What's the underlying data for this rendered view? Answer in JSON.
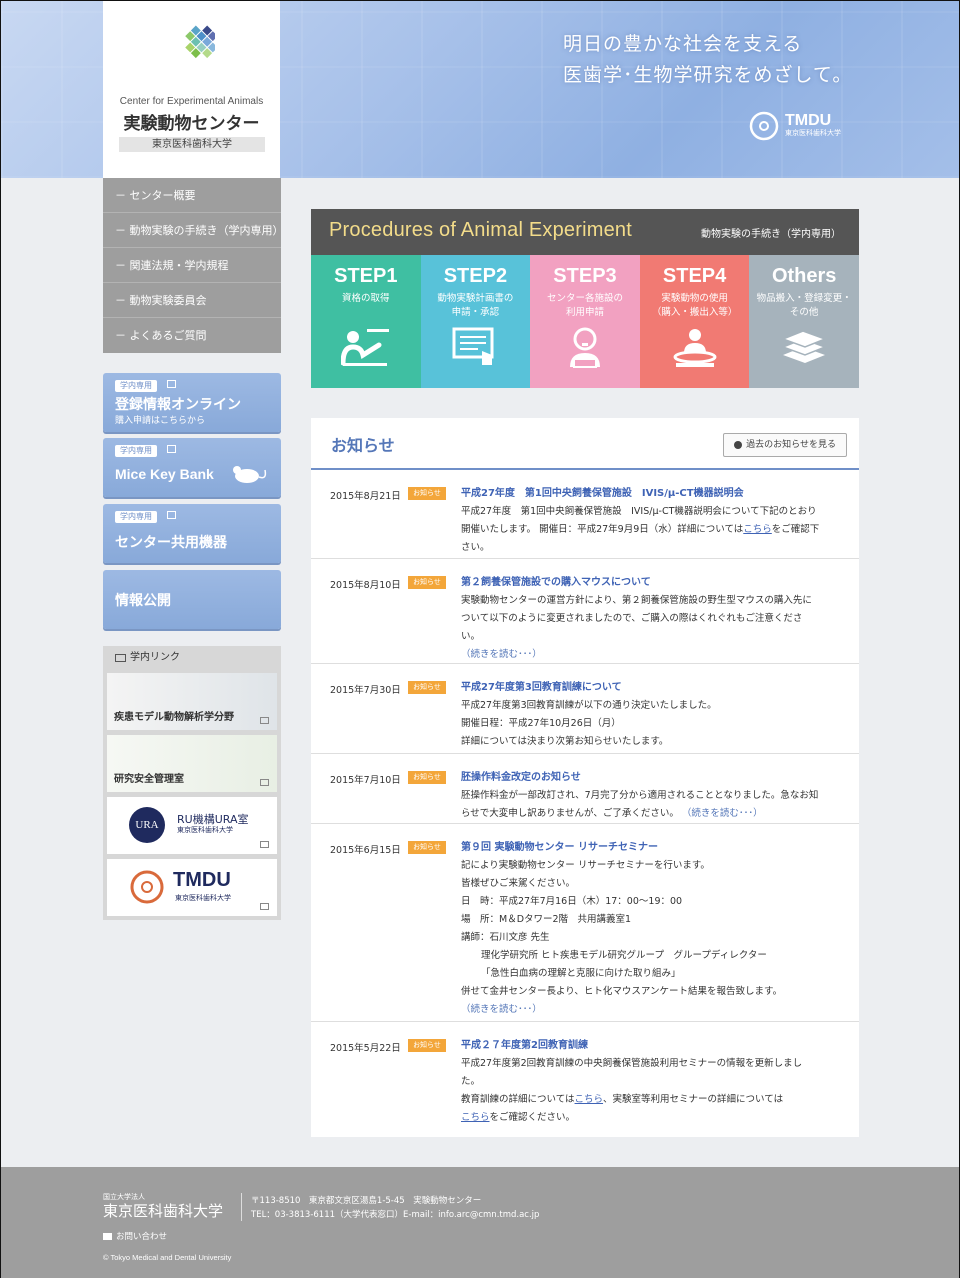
{
  "header": {
    "logo_en": "Center for Experimental Animals",
    "logo_ja": "実験動物センター",
    "logo_univ": "東京医科歯科大学",
    "catch_line1": "明日の豊かな社会を支える",
    "catch_line2": "医歯学･生物学研究をめざして。",
    "tmdu": "TMDU",
    "tmdu_sub": "東京医科歯科大学"
  },
  "sidenav": [
    "－ センター概要",
    "－ 動物実験の手続き（学内専用）",
    "－ 関連法規・学内規程",
    "－ 動物実験委員会",
    "－ よくあるご質問"
  ],
  "banners": {
    "online": {
      "tag": "学内専用",
      "title": "登録情報オンライン",
      "sub": "購入申請はこちらから"
    },
    "mice": {
      "tag": "学内専用",
      "title": "Mice Key Bank"
    },
    "equip": {
      "tag": "学内専用",
      "title": "センター共用機器"
    },
    "info": {
      "title": "情報公開"
    }
  },
  "links": {
    "title": "学内リンク",
    "items": [
      "疾患モデル動物解析学分野",
      "研究安全管理室",
      "RU機構URA室",
      "TMDU"
    ],
    "ura_logo": "URA",
    "ura_sub": "東京医科歯科大学",
    "tmdu_sub": "東京医科歯科大学"
  },
  "procedures": {
    "title_en": "Procedures of Animal Experiment",
    "title_ja": "動物実験の手続き（学内専用）",
    "steps": [
      {
        "label": "STEP1",
        "line1": "資格の取得",
        "line2": "",
        "color": "#3fbfa2"
      },
      {
        "label": "STEP2",
        "line1": "動物実験計画書の",
        "line2": "申請・承認",
        "color": "#58c2d9"
      },
      {
        "label": "STEP3",
        "line1": "センター各施設の",
        "line2": "利用申請",
        "color": "#f2a1c1"
      },
      {
        "label": "STEP4",
        "line1": "実験動物の使用",
        "line2": "（購入・搬出入等）",
        "color": "#f17a73"
      },
      {
        "label": "Others",
        "line1": "物品搬入・登録変更・",
        "line2": "その他",
        "color": "#a6b3bc"
      }
    ]
  },
  "news": {
    "title": "お知らせ",
    "archive_btn": "過去のお知らせを見る",
    "badge": "お知らせ",
    "more": "（続きを読む･･･）",
    "entries": [
      {
        "date": "2015年8月21日",
        "title": "平成27年度　第1回中央飼養保管施設　IVIS/μ-CT機器説明会",
        "l1": "平成27年度　第1回中央飼養保管施設　IVIS/μ-CT機器説明会について下記のとおり",
        "l2a": "開催いたします。 開催日：平成27年9月9日（水）詳細については",
        "l2link": "こちら",
        "l2b": "をご確認下",
        "l3": "さい。"
      },
      {
        "date": "2015年8月10日",
        "title": "第２飼養保管施設での購入マウスについて",
        "l1": "実験動物センターの運営方針により、第２飼養保管施設の野生型マウスの購入先に",
        "l2": "ついて以下のように変更されましたので、ご購入の際はくれぐれもご注意くださ",
        "l3": "い。"
      },
      {
        "date": "2015年7月30日",
        "title": "平成27年度第3回教育訓練について",
        "l1": "平成27年度第3回教育訓練が以下の通り決定いたしました。",
        "l2": "開催日程：平成27年10月26日（月）",
        "l3": "詳細については決まり次第お知らせいたします。"
      },
      {
        "date": "2015年7月10日",
        "title": "胚操作料金改定のお知らせ",
        "l1": "胚操作料金が一部改訂され、7月完了分から適用されることとなりました。急なお知",
        "l2": "らせで大変申し訳ありませんが、ご了承ください。"
      },
      {
        "date": "2015年6月15日",
        "title": "第９回 実験動物センター リサーチセミナー",
        "l1": "記により実験動物センター リサーチセミナーを行います。",
        "l2": "皆様ぜひご来駕ください。",
        "l3": "日　時：平成27年7月16日（木）17：00～19：00",
        "l4": "場　所：M＆Dタワー2階　共用講義室1",
        "l5": "講師：石川文彦 先生",
        "l6": "理化学研究所 ヒト疾患モデル研究グループ　グループディレクター",
        "l7": "「急性白血病の理解と克服に向けた取り組み」",
        "l8": "併せて金井センター長より、ヒト化マウスアンケート結果を報告致します。"
      },
      {
        "date": "2015年5月22日",
        "title": "平成２７年度第2回教育訓練",
        "l1": "平成27年度第2回教育訓練の中央飼養保管施設利用セミナーの情報を更新しまし",
        "l2": "た。",
        "l3a": "教育訓練の詳細については",
        "l3link": "こちら",
        "l3b": "、実験室等利用セミナーの詳細については",
        "l4link": "こちら",
        "l4b": "をご確認ください。"
      }
    ]
  },
  "footer": {
    "univ_small": "国立大学法人",
    "univ": "東京医科歯科大学",
    "addr1": "〒113-8510　東京都文京区湯島1-5-45　実験動物センター",
    "addr2": "TEL：03-3813-6111（大学代表窓口）E-mail：info.arc@cmn.tmd.ac.jp",
    "contact": "お問い合わせ",
    "copyright": "© Tokyo Medical and Dental University"
  }
}
